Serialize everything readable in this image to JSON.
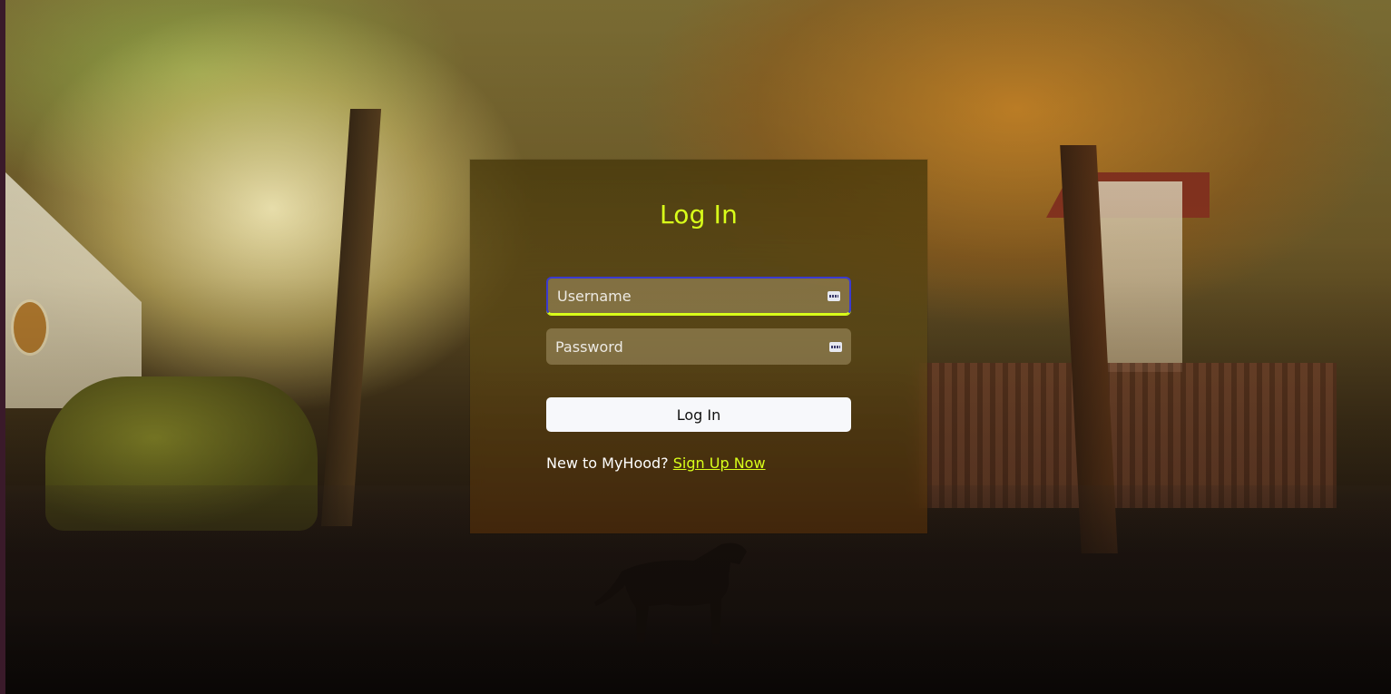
{
  "app": {
    "brand_name": "MyHood"
  },
  "login": {
    "title": "Log In",
    "username": {
      "placeholder": "Username",
      "value": ""
    },
    "password": {
      "placeholder": "Password",
      "value": ""
    },
    "submit_label": "Log In",
    "signup_prompt": "New to MyHood?",
    "signup_link_label": "Sign Up Now"
  },
  "icons": {
    "field_autofill_icon": "keyboard-icon"
  },
  "colors": {
    "accent": "#d9ff1a",
    "focus_outline": "#3a3acf",
    "button_bg": "#f7f8fb",
    "card_bg": "#5a4614"
  }
}
